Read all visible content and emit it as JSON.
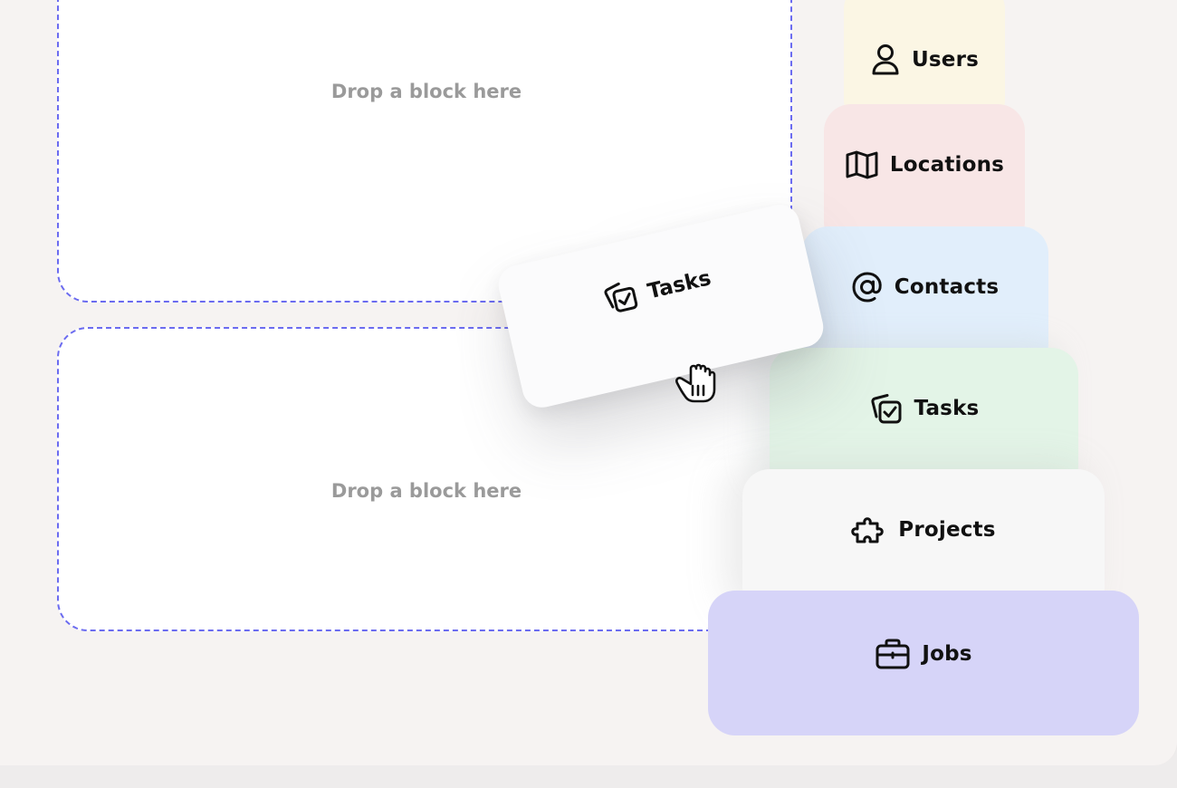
{
  "dropzones": [
    {
      "label": "Drop a block here"
    },
    {
      "label": "Drop a block here"
    }
  ],
  "blocks": [
    {
      "label": "Users",
      "icon": "user-icon",
      "color": "#fbf6e4"
    },
    {
      "label": "Locations",
      "icon": "map-icon",
      "color": "#f8e6e6"
    },
    {
      "label": "Contacts",
      "icon": "at-sign-icon",
      "color": "#e1eefb"
    },
    {
      "label": "Tasks",
      "icon": "task-check-icon",
      "color": "#e3f4e7"
    },
    {
      "label": "Projects",
      "icon": "puzzle-icon",
      "color": "#f7f7f7"
    },
    {
      "label": "Jobs",
      "icon": "briefcase-icon",
      "color": "#d6d4f8"
    }
  ],
  "dragged_block": {
    "label": "Tasks",
    "icon": "task-check-icon"
  },
  "cursor": {
    "icon": "grab-hand-cursor-icon"
  },
  "accent_color": "#6b6bf0"
}
